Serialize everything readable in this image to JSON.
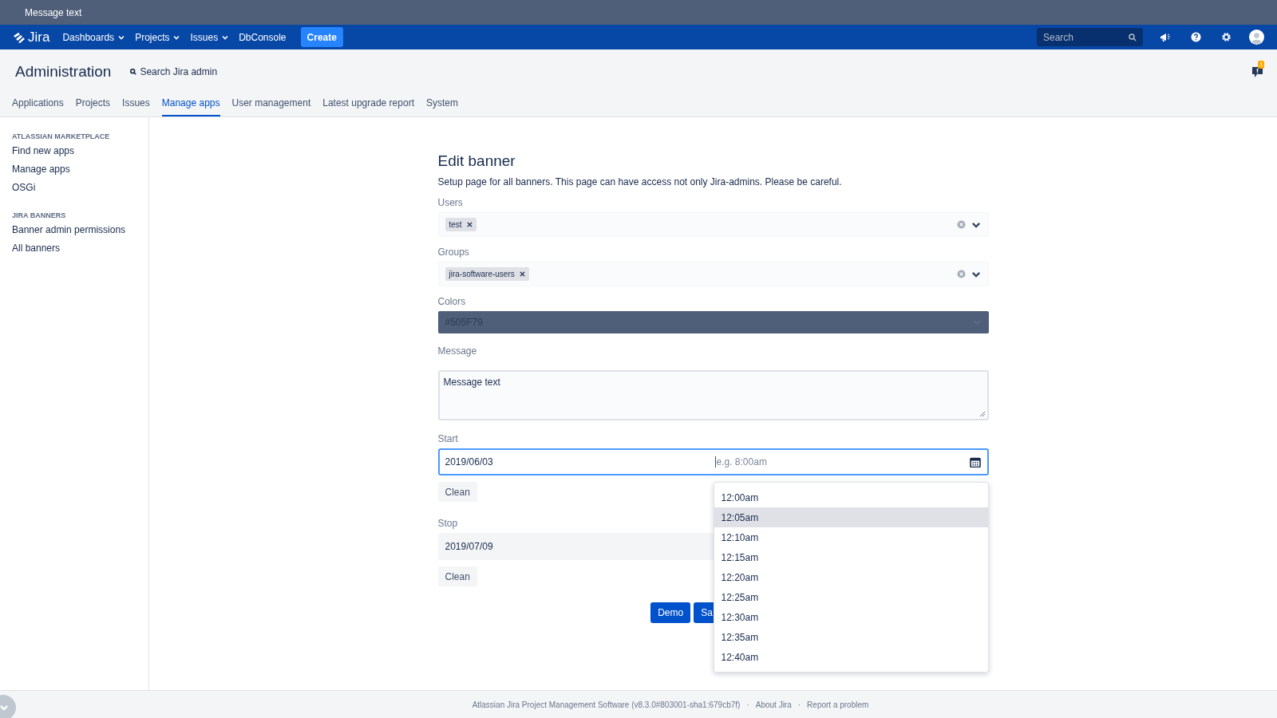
{
  "banner": {
    "message": "Message text",
    "color": "#505f79"
  },
  "nav": {
    "logo": "Jira",
    "items": [
      {
        "label": "Dashboards",
        "dropdown": true
      },
      {
        "label": "Projects",
        "dropdown": true
      },
      {
        "label": "Issues",
        "dropdown": true
      },
      {
        "label": "DbConsole",
        "dropdown": false
      }
    ],
    "create": "Create",
    "search": {
      "placeholder": "Search"
    },
    "notification_count": "1"
  },
  "admin": {
    "title": "Administration",
    "search": "Search Jira admin",
    "tabs": [
      {
        "label": "Applications",
        "selected": false
      },
      {
        "label": "Projects",
        "selected": false
      },
      {
        "label": "Issues",
        "selected": false
      },
      {
        "label": "Manage apps",
        "selected": true
      },
      {
        "label": "User management",
        "selected": false
      },
      {
        "label": "Latest upgrade report",
        "selected": false
      },
      {
        "label": "System",
        "selected": false
      }
    ]
  },
  "sidebar": {
    "sections": [
      {
        "heading": "ATLASSIAN MARKETPLACE",
        "items": [
          "Find new apps",
          "Manage apps",
          "OSGi"
        ]
      },
      {
        "heading": "JIRA BANNERS",
        "items": [
          "Banner admin permissions",
          "All banners"
        ]
      }
    ]
  },
  "form": {
    "title": "Edit banner",
    "description": "Setup page for all banners. This page can have access not only Jira-admins. Please be careful.",
    "users": {
      "label": "Users",
      "tags": [
        "test"
      ]
    },
    "groups": {
      "label": "Groups",
      "tags": [
        "jira-software-users"
      ]
    },
    "colors": {
      "label": "Colors",
      "value": "#505F79"
    },
    "message": {
      "label": "Message",
      "value": "Message text"
    },
    "start": {
      "label": "Start",
      "date": "2019/06/03",
      "time_placeholder": "e.g. 8:00am",
      "focused": true,
      "clean": "Clean"
    },
    "stop": {
      "label": "Stop",
      "date": "2019/07/09",
      "focused": false,
      "clean": "Clean"
    },
    "buttons": [
      "Demo",
      "Sa"
    ],
    "time_options": [
      {
        "label": "12:00am",
        "selected": false
      },
      {
        "label": "12:05am",
        "selected": true
      },
      {
        "label": "12:10am",
        "selected": false
      },
      {
        "label": "12:15am",
        "selected": false
      },
      {
        "label": "12:20am",
        "selected": false
      },
      {
        "label": "12:25am",
        "selected": false
      },
      {
        "label": "12:30am",
        "selected": false
      },
      {
        "label": "12:35am",
        "selected": false
      },
      {
        "label": "12:40am",
        "selected": false
      }
    ]
  },
  "footer": {
    "separator": "·",
    "links": [
      "Atlassian Jira Project Management Software (v8.3.0#803001-sha1:679cb7f)",
      "About Jira",
      "Report a problem"
    ]
  }
}
